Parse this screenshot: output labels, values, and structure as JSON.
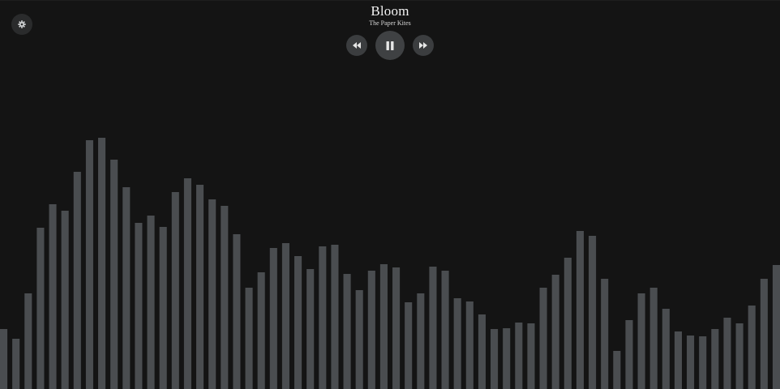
{
  "player": {
    "title": "Bloom",
    "artist": "The Paper Kites"
  },
  "icons": {
    "settings": "gear-icon",
    "rewind": "rewind-icon",
    "pause": "pause-icon",
    "fast_forward": "fast-forward-icon"
  },
  "colors": {
    "background": "#141414",
    "bar": "#4a4d50",
    "button": "#3b3d3f",
    "text": "#f2f2f2"
  },
  "visualizer": {
    "levels": [
      0.156,
      0.131,
      0.248,
      0.417,
      0.477,
      0.46,
      0.56,
      0.642,
      0.648,
      0.592,
      0.521,
      0.429,
      0.448,
      0.419,
      0.508,
      0.544,
      0.528,
      0.49,
      0.473,
      0.4,
      0.263,
      0.302,
      0.365,
      0.377,
      0.344,
      0.31,
      0.369,
      0.373,
      0.298,
      0.256,
      0.306,
      0.323,
      0.315,
      0.225,
      0.248,
      0.317,
      0.306,
      0.235,
      0.227,
      0.194,
      0.156,
      0.158,
      0.173,
      0.171,
      0.263,
      0.296,
      0.34,
      0.408,
      0.396,
      0.285,
      0.1,
      0.179,
      0.248,
      0.263,
      0.208,
      0.15,
      0.14,
      0.138,
      0.156,
      0.185,
      0.171,
      0.217,
      0.285,
      0.321
    ]
  }
}
